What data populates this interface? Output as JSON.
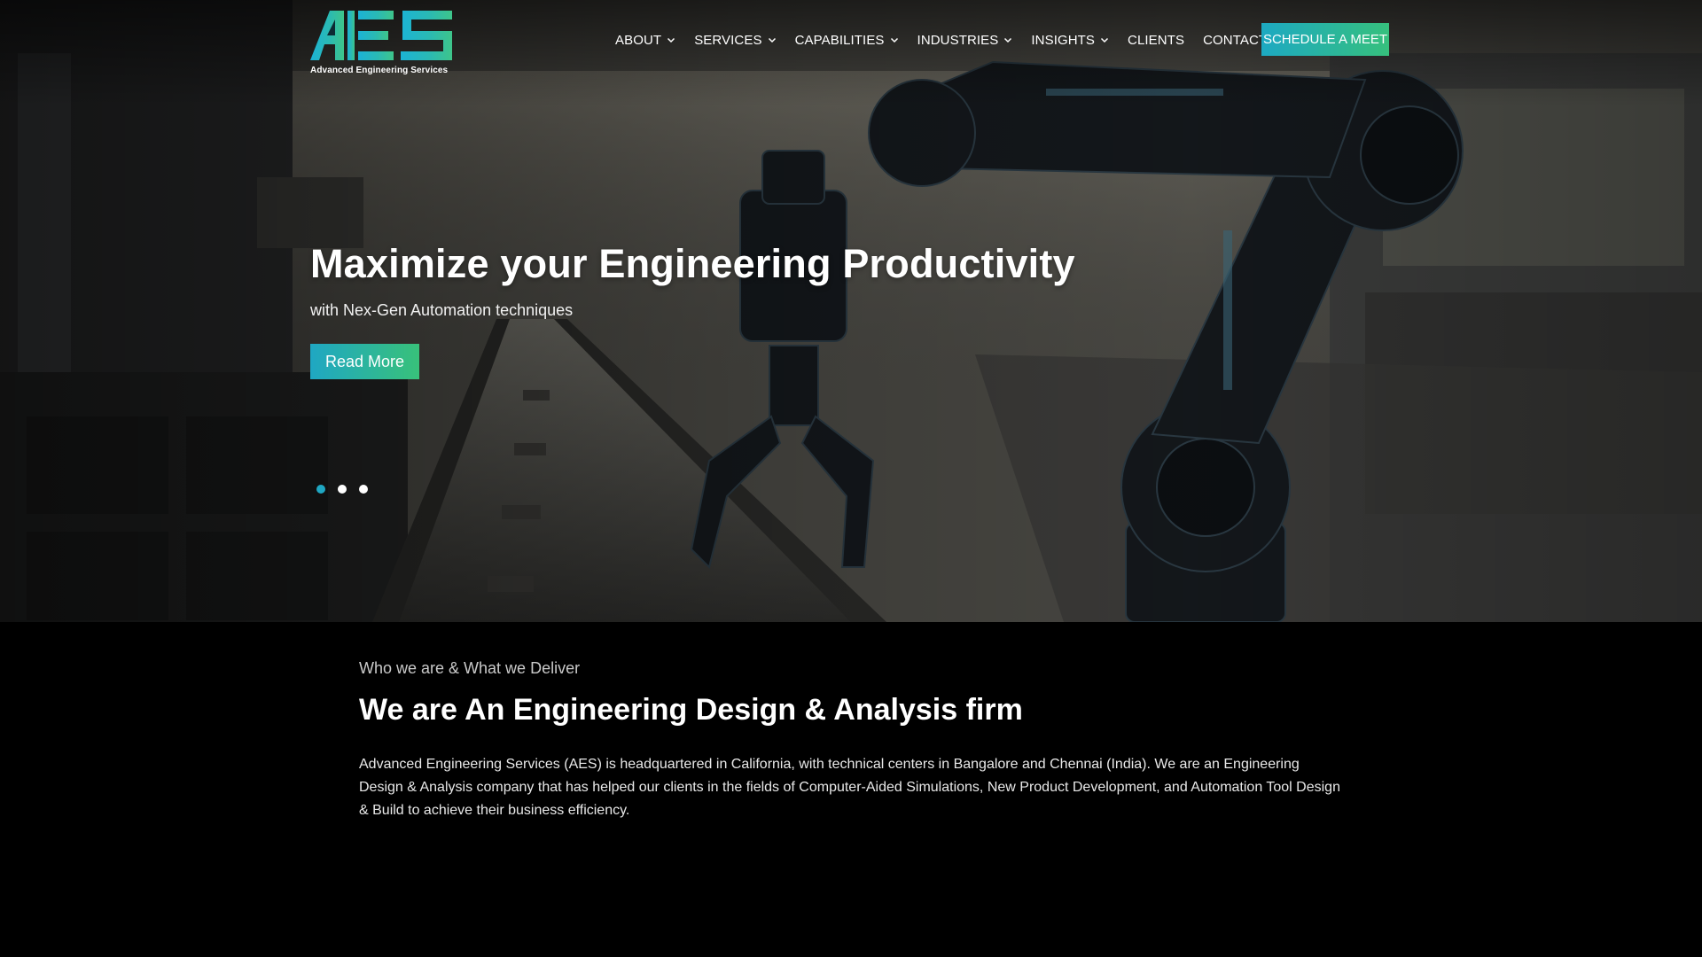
{
  "brand": {
    "logo_text": "AES",
    "logo_subtitle": "Advanced Engineering Services",
    "colors": {
      "gradient_start": "#1da9c2",
      "gradient_end": "#36c07d",
      "dot_active": "#1fa7c3"
    }
  },
  "nav": {
    "items": [
      {
        "label": "ABOUT",
        "has_dropdown": true
      },
      {
        "label": "SERVICES",
        "has_dropdown": true
      },
      {
        "label": "CAPABILITIES",
        "has_dropdown": true
      },
      {
        "label": "INDUSTRIES",
        "has_dropdown": true
      },
      {
        "label": "INSIGHTS",
        "has_dropdown": true
      },
      {
        "label": "CLIENTS",
        "has_dropdown": false
      },
      {
        "label": "CONTACT",
        "has_dropdown": false
      }
    ],
    "cta_label": "SCHEDULE A MEET"
  },
  "hero": {
    "title": "Maximize your Engineering Productivity",
    "subtitle": "with Nex-Gen Automation techniques",
    "button_label": "Read More",
    "slides_count": 3,
    "active_slide": 1
  },
  "about": {
    "eyebrow": "Who we are & What we Deliver",
    "title": "We are An Engineering Design & Analysis firm",
    "body": "Advanced Engineering Services (AES) is headquartered in California, with technical centers in Bangalore and Chennai (India). We are an Engineering Design & Analysis company that has helped our clients in the fields of Computer-Aided Simulations, New Product Development, and Automation Tool Design & Build to achieve their business efficiency."
  }
}
